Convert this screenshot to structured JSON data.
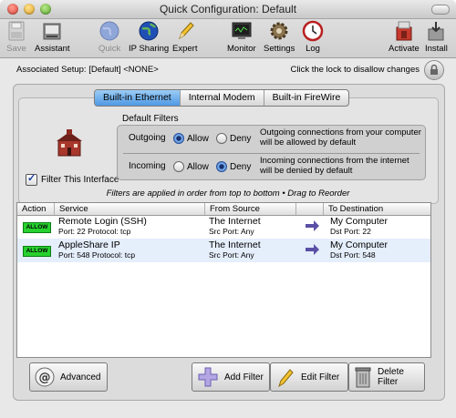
{
  "window": {
    "title": "Quick Configuration: Default"
  },
  "toolbar": {
    "items": [
      {
        "label": "Save",
        "icon": "save-icon",
        "enabled": false
      },
      {
        "label": "Assistant",
        "icon": "assistant-icon",
        "enabled": true
      },
      {
        "label": "Quick",
        "icon": "quick-globe-icon",
        "enabled": false
      },
      {
        "label": "IP Sharing",
        "icon": "ip-sharing-globe-icon",
        "enabled": true
      },
      {
        "label": "Expert",
        "icon": "pencil-icon",
        "enabled": true
      },
      {
        "label": "Monitor",
        "icon": "monitor-icon",
        "enabled": true
      },
      {
        "label": "Settings",
        "icon": "gear-icon",
        "enabled": true
      },
      {
        "label": "Log",
        "icon": "clock-icon",
        "enabled": true
      },
      {
        "label": "Activate",
        "icon": "activate-icon",
        "enabled": true
      },
      {
        "label": "Install",
        "icon": "install-icon",
        "enabled": true
      }
    ]
  },
  "setup": {
    "associated": "Associated Setup: [Default] <NONE>",
    "lock_text": "Click the lock to disallow changes"
  },
  "tabs": [
    "Built-in Ethernet",
    "Internal Modem",
    "Built-in FireWire"
  ],
  "active_tab": 0,
  "interface": {
    "filter_label": "Filter This Interface",
    "filter_checked": true
  },
  "default_filters": {
    "title": "Default Filters",
    "rows": [
      {
        "name": "Outgoing",
        "allow": "Allow",
        "deny": "Deny",
        "selected": "allow",
        "description": "Outgoing connections from your computer will be allowed by default"
      },
      {
        "name": "Incoming",
        "allow": "Allow",
        "deny": "Deny",
        "selected": "deny",
        "description": "Incoming connections from the internet will be denied by default"
      }
    ]
  },
  "note": "Filters are applied in order from top to bottom • Drag to Reorder",
  "table": {
    "columns": [
      "Action",
      "Service",
      "From Source",
      "To Destination"
    ],
    "rows": [
      {
        "action": "ALLOW",
        "service": "Remote Login (SSH)",
        "service_detail": "Port: 22  Protocol: tcp",
        "source": "The Internet",
        "source_detail": "Src Port: Any",
        "destination": "My Computer",
        "destination_detail": "Dst Port: 22"
      },
      {
        "action": "ALLOW",
        "service": "AppleShare IP",
        "service_detail": "Port: 548  Protocol: tcp",
        "source": "The Internet",
        "source_detail": "Src Port: Any",
        "destination": "My Computer",
        "destination_detail": "Dst Port: 548"
      }
    ]
  },
  "buttons": {
    "advanced": "Advanced",
    "add": "Add Filter",
    "edit": "Edit Filter",
    "delete": "Delete Filter"
  },
  "colors": {
    "allow_badge": "#27d12e",
    "tab_active": "#4f98e3",
    "arrow": "#5a4fa6"
  }
}
